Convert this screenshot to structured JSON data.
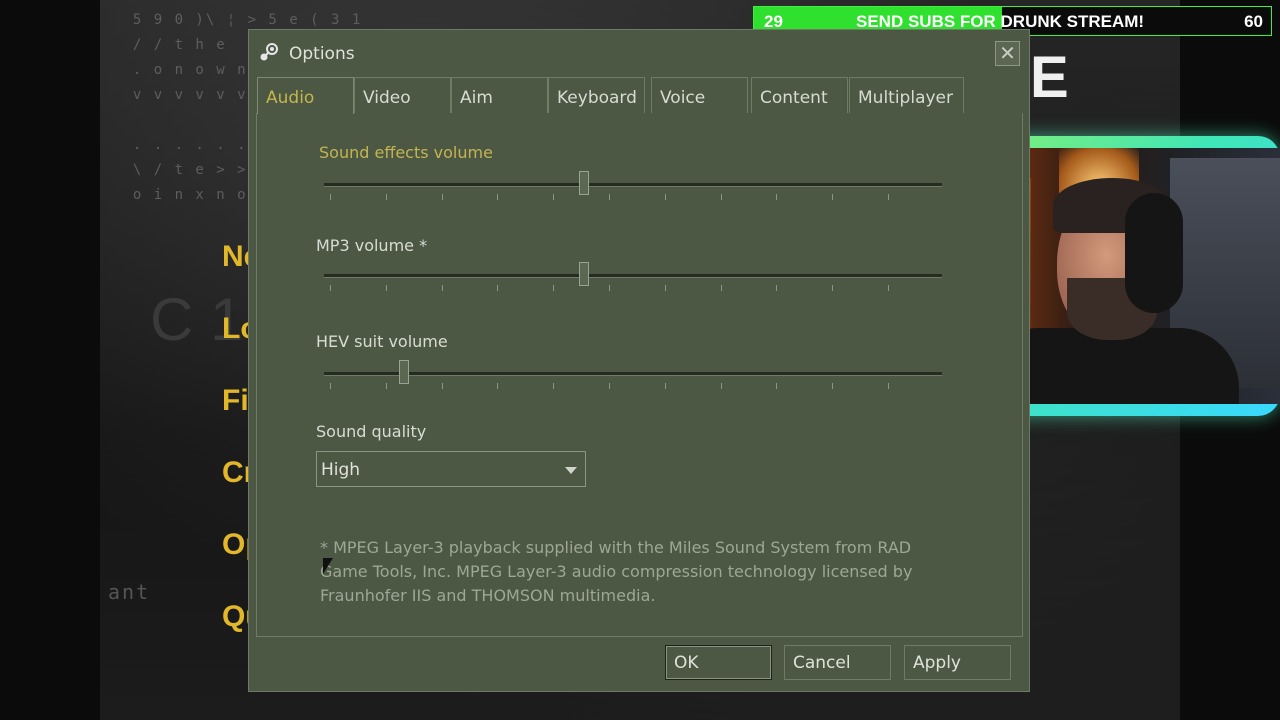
{
  "dialog": {
    "title": "Options",
    "close_label": "✕",
    "tabs": [
      {
        "label": "Audio",
        "active": true
      },
      {
        "label": "Video",
        "active": false
      },
      {
        "label": "Aim",
        "active": false
      },
      {
        "label": "Keyboard",
        "active": false
      },
      {
        "label": "Voice",
        "active": false
      },
      {
        "label": "Content",
        "active": false
      },
      {
        "label": "Multiplayer",
        "active": false
      }
    ],
    "audio": {
      "sliders": [
        {
          "label": "Sound effects volume",
          "value": 0.42,
          "highlighted": true
        },
        {
          "label": "MP3 volume *",
          "value": 0.42,
          "highlighted": false
        },
        {
          "label": "HEV suit volume",
          "value": 0.13,
          "highlighted": false
        }
      ],
      "tick_count": 11,
      "sound_quality": {
        "label": "Sound quality",
        "value": "High"
      },
      "note": "* MPEG Layer-3 playback supplied with the Miles Sound System from RAD Game Tools, Inc. MPEG Layer-3 audio compression technology licensed by Fraunhofer IIS and THOMSON multimedia."
    },
    "buttons": {
      "ok": "OK",
      "cancel": "Cancel",
      "apply": "Apply"
    }
  },
  "banner": {
    "left_count": "29",
    "message": "SEND SUBS FOR DRUNK STREAM!",
    "right_count": "60",
    "progress": 0.48,
    "color": "#2fe02f"
  },
  "game_menu": [
    "Ne",
    "Lo",
    "Fi",
    "Cr",
    "Op",
    "Qu"
  ],
  "game_logo_letter": "E",
  "colors": {
    "dialog_bg": "#4c5844",
    "highlight": "#c4b550"
  }
}
